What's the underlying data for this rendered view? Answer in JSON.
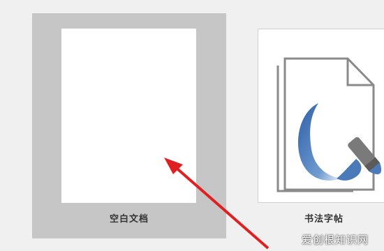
{
  "templates": [
    {
      "label": "空白文档",
      "selected": true,
      "icon": "blank-page"
    },
    {
      "label": "书法字帖",
      "selected": false,
      "icon": "calligraphy-brush-icon"
    }
  ],
  "watermark": "爱创根知识网",
  "colors": {
    "selected_tile_bg": "#c6c6c6",
    "annotation_arrow": "#e02020",
    "brush_stroke": "#4a7ab8"
  }
}
